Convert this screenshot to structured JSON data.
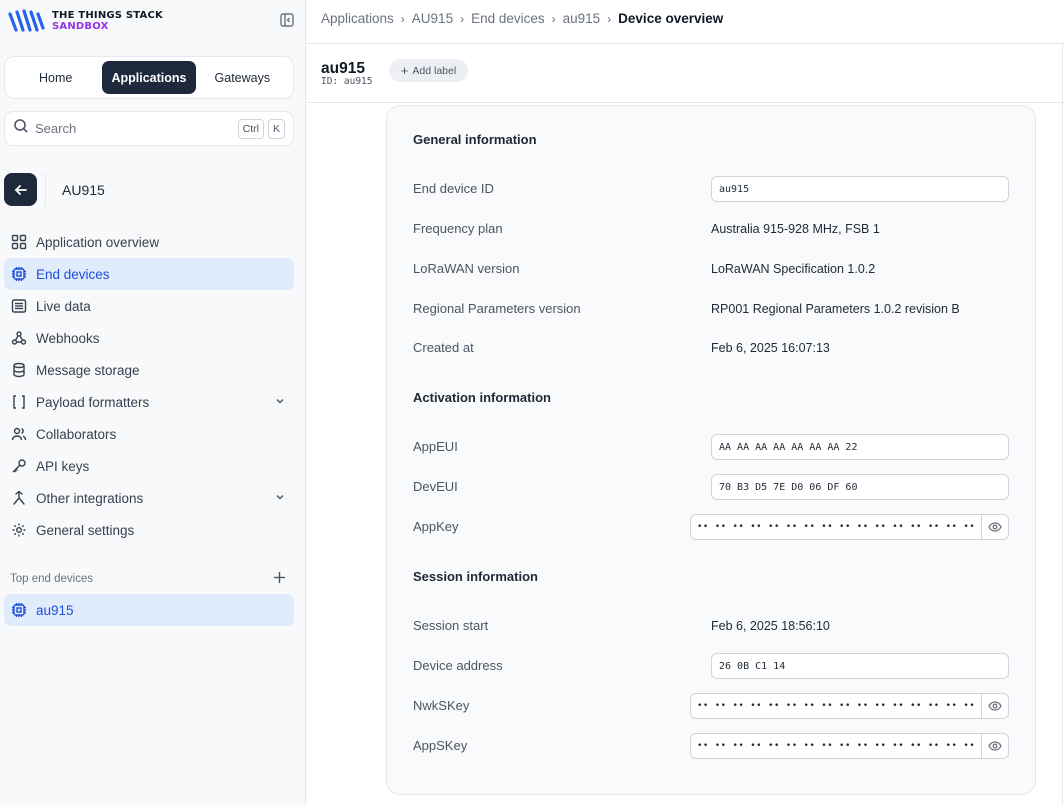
{
  "brand": {
    "line1": "THE THINGS STACK",
    "line2": "SANDBOX"
  },
  "switcher": {
    "home": "Home",
    "applications": "Applications",
    "gateways": "Gateways"
  },
  "search": {
    "placeholder": "Search",
    "kbd1": "Ctrl",
    "kbd2": "K"
  },
  "app": {
    "name": "AU915"
  },
  "nav": [
    {
      "label": "Application overview",
      "icon": "grid-icon"
    },
    {
      "label": "End devices",
      "icon": "chip-icon",
      "active": true
    },
    {
      "label": "Live data",
      "icon": "list-icon"
    },
    {
      "label": "Webhooks",
      "icon": "webhook-icon"
    },
    {
      "label": "Message storage",
      "icon": "database-icon"
    },
    {
      "label": "Payload formatters",
      "icon": "code-icon",
      "expandable": true
    },
    {
      "label": "Collaborators",
      "icon": "users-icon"
    },
    {
      "label": "API keys",
      "icon": "key-icon"
    },
    {
      "label": "Other integrations",
      "icon": "integration-icon",
      "expandable": true
    },
    {
      "label": "General settings",
      "icon": "gear-icon"
    }
  ],
  "top_devices": {
    "heading": "Top end devices",
    "items": [
      "au915"
    ]
  },
  "breadcrumb": [
    "Applications",
    "AU915",
    "End devices",
    "au915",
    "Device overview"
  ],
  "device": {
    "name": "au915",
    "id_line": "ID: au915",
    "add_label": "Add label"
  },
  "general": {
    "title": "General information",
    "end_device_id_label": "End device ID",
    "end_device_id": "au915",
    "frequency_plan_label": "Frequency plan",
    "frequency_plan": "Australia 915-928 MHz, FSB 1",
    "lorawan_version_label": "LoRaWAN version",
    "lorawan_version": "LoRaWAN Specification 1.0.2",
    "regional_label": "Regional Parameters version",
    "regional": "RP001 Regional Parameters 1.0.2 revision B",
    "created_label": "Created at",
    "created": "Feb 6, 2025 16:07:13"
  },
  "activation": {
    "title": "Activation information",
    "appeui_label": "AppEUI",
    "appeui": "AA AA AA AA AA AA AA 22",
    "deveui_label": "DevEUI",
    "deveui": "70 B3 D5 7E D0 06 DF 60",
    "appkey_label": "AppKey",
    "appkey_masked": "•• •• •• •• •• •• •• •• •• •• •• •• •• •• •• ••"
  },
  "session": {
    "title": "Session information",
    "start_label": "Session start",
    "start": "Feb 6, 2025 18:56:10",
    "devaddr_label": "Device address",
    "devaddr": "26 0B C1 14",
    "nwkskey_label": "NwkSKey",
    "nwkskey_masked": "•• •• •• •• •• •• •• •• •• •• •• •• •• •• •• ••",
    "appskey_label": "AppSKey",
    "appskey_masked": "•• •• •• •• •• •• •• •• •• •• •• •• •• •• •• ••"
  },
  "colors": {
    "accent": "#1d4ed8",
    "active_bg": "#e0ecfb",
    "dark_button": "#1e293b",
    "brand_purple": "#9333ea"
  }
}
